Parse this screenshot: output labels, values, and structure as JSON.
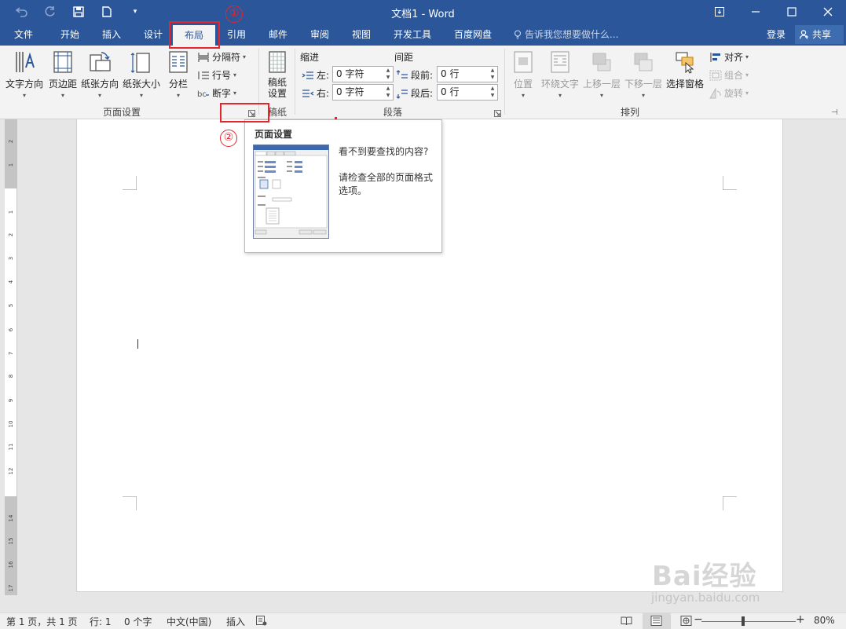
{
  "titlebar": {
    "title": "文档1 - Word",
    "qat": {
      "undo_icon": "undo-icon",
      "redo_icon": "redo-icon",
      "save_icon": "save-icon",
      "new_icon": "new-document-icon",
      "customize_icon": "customize-qat-icon"
    }
  },
  "tabs": [
    {
      "label": "文件"
    },
    {
      "label": "开始"
    },
    {
      "label": "插入"
    },
    {
      "label": "设计"
    },
    {
      "label": "布局"
    },
    {
      "label": "引用"
    },
    {
      "label": "邮件"
    },
    {
      "label": "审阅"
    },
    {
      "label": "视图"
    },
    {
      "label": "开发工具"
    },
    {
      "label": "百度网盘"
    }
  ],
  "active_tab": "布局",
  "tell_me": "告诉我您想要做什么...",
  "login": "登录",
  "share": "共享",
  "ribbon": {
    "page_setup": {
      "label": "页面设置",
      "text_direction": "文字方向",
      "margins": "页边距",
      "orientation": "纸张方向",
      "size": "纸张大小",
      "columns": "分栏",
      "breaks": "分隔符",
      "line_numbers": "行号",
      "hyphenation": "断字"
    },
    "manuscript": {
      "label": "稿纸",
      "button": "稿纸\n设置",
      "button_line1": "稿纸",
      "button_line2": "设置"
    },
    "paragraph": {
      "label": "段落",
      "indent": "缩进",
      "spacing": "间距",
      "left": "左:",
      "right": "右:",
      "before": "段前:",
      "after": "段后:",
      "left_value": "0 字符",
      "right_value": "0 字符",
      "before_value": "0 行",
      "after_value": "0 行"
    },
    "arrange": {
      "label": "排列",
      "position": "位置",
      "wrap_text": "环绕文字",
      "bring_forward": "上移一层",
      "send_backward": "下移一层",
      "selection_pane": "选择窗格",
      "align": "对齐",
      "group": "组合",
      "rotate": "旋转"
    }
  },
  "tooltip": {
    "title": "页面设置",
    "line1": "看不到要查找的内容?",
    "line2": "请检查全部的页面格式选项。"
  },
  "annotations": {
    "one": "①",
    "two": "②"
  },
  "ruler_numbers": [
    "2",
    "1",
    "1",
    "2",
    "3",
    "4",
    "5",
    "6",
    "7",
    "8",
    "9",
    "10",
    "11",
    "12",
    "14",
    "15",
    "16",
    "17"
  ],
  "status": {
    "page": "第 1 页，共 1 页",
    "line": "行: 1",
    "words": "0 个字",
    "language": "中文(中国)",
    "mode": "插入",
    "zoom": "80%",
    "zoom_minus": "−",
    "zoom_plus": "+"
  },
  "watermark": {
    "text": "Bai经验",
    "url": "jingyan.baidu.com"
  },
  "colors": {
    "word_blue": "#2b579a",
    "annotation_red": "#e8242c",
    "ribbon_bg": "#f3f3f3"
  }
}
